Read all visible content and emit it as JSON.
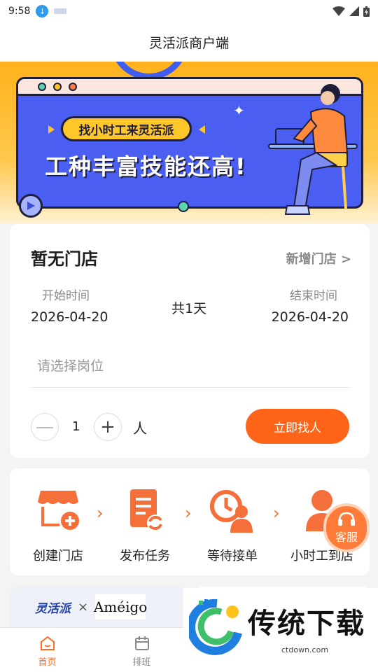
{
  "status_bar": {
    "time": "9:58"
  },
  "header": {
    "title": "灵活派商户端"
  },
  "banner": {
    "tag": "找小时工来灵活派",
    "slogan": "工种丰富技能还高!"
  },
  "store_card": {
    "title": "暂无门店",
    "add_store": "新增门店 >",
    "start_label": "开始时间",
    "start_date": "2026-04-20",
    "end_label": "结束时间",
    "end_date": "2026-04-20",
    "duration": "共1天",
    "position_placeholder": "请选择岗位",
    "quantity": "1",
    "unit": "人",
    "minus": "—",
    "plus": "+",
    "find_button": "立即找人"
  },
  "steps": {
    "items": [
      {
        "label": "创建门店",
        "icon": "store-add-icon"
      },
      {
        "label": "发布任务",
        "icon": "task-publish-icon"
      },
      {
        "label": "等待接单",
        "icon": "waiting-icon"
      },
      {
        "label": "小时工到店",
        "icon": "worker-arrive-icon"
      }
    ]
  },
  "service": {
    "label": "客服",
    "icon": "headset-icon"
  },
  "partner": {
    "brand": "灵活派",
    "x": "×",
    "partner_brand": "Améigo"
  },
  "tabs": [
    {
      "label": "首页",
      "icon": "home-icon",
      "active": true
    },
    {
      "label": "排班",
      "icon": "calendar-icon",
      "active": false
    }
  ],
  "watermark": {
    "title": "传统下载",
    "url": "ctdown.com"
  },
  "colors": {
    "accent": "#ff6418",
    "banner_blue": "#4a5ff2",
    "banner_yellow": "#ffb21c"
  }
}
